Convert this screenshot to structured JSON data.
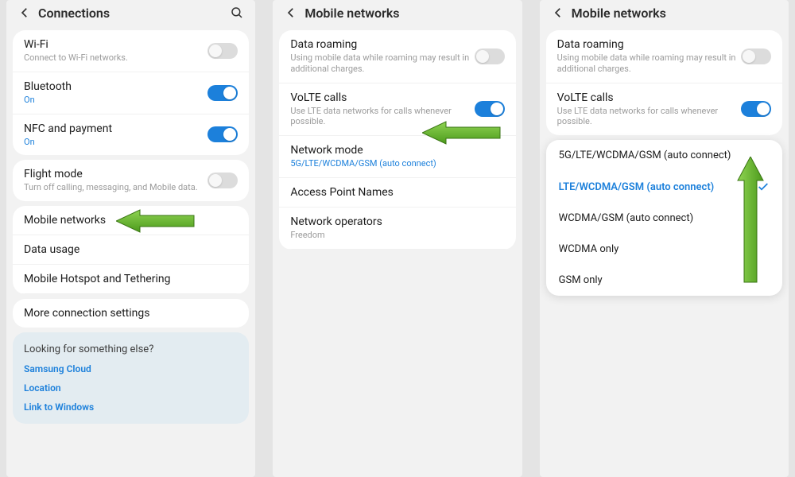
{
  "screen1": {
    "title": "Connections",
    "groups": {
      "g1": [
        {
          "title": "Wi-Fi",
          "sub": "Connect to Wi-Fi networks.",
          "toggle": "off"
        },
        {
          "title": "Bluetooth",
          "sub": "On",
          "subAccent": true,
          "toggle": "on"
        },
        {
          "title": "NFC and payment",
          "sub": "On",
          "subAccent": true,
          "toggle": "on"
        }
      ],
      "g2": [
        {
          "title": "Flight mode",
          "sub": "Turn off calling, messaging, and Mobile data.",
          "toggle": "off"
        }
      ],
      "g3": [
        {
          "title": "Mobile networks"
        },
        {
          "title": "Data usage"
        },
        {
          "title": "Mobile Hotspot and Tethering"
        }
      ],
      "g4": [
        {
          "title": "More connection settings"
        }
      ]
    },
    "info": {
      "title": "Looking for something else?",
      "links": [
        "Samsung Cloud",
        "Location",
        "Link to Windows"
      ]
    }
  },
  "screen2": {
    "title": "Mobile networks",
    "items": [
      {
        "title": "Data roaming",
        "sub": "Using mobile data while roaming may result in additional charges.",
        "toggle": "off"
      },
      {
        "title": "VoLTE calls",
        "sub": "Use LTE data networks for calls whenever possible.",
        "toggle": "on"
      },
      {
        "title": "Network mode",
        "sub": "5G/LTE/WCDMA/GSM (auto connect)",
        "subAccent": true
      },
      {
        "title": "Access Point Names"
      },
      {
        "title": "Network operators",
        "sub": "Freedom"
      }
    ]
  },
  "screen3": {
    "title": "Mobile networks",
    "items": [
      {
        "title": "Data roaming",
        "sub": "Using mobile data while roaming may result in additional charges.",
        "toggle": "off"
      },
      {
        "title": "VoLTE calls",
        "sub": "Use LTE data networks for calls whenever possible.",
        "toggle": "on"
      }
    ],
    "options": [
      {
        "label": "5G/LTE/WCDMA/GSM (auto connect)",
        "selected": false
      },
      {
        "label": "LTE/WCDMA/GSM (auto connect)",
        "selected": true
      },
      {
        "label": "WCDMA/GSM (auto connect)",
        "selected": false
      },
      {
        "label": "WCDMA only",
        "selected": false
      },
      {
        "label": "GSM only",
        "selected": false
      }
    ]
  }
}
